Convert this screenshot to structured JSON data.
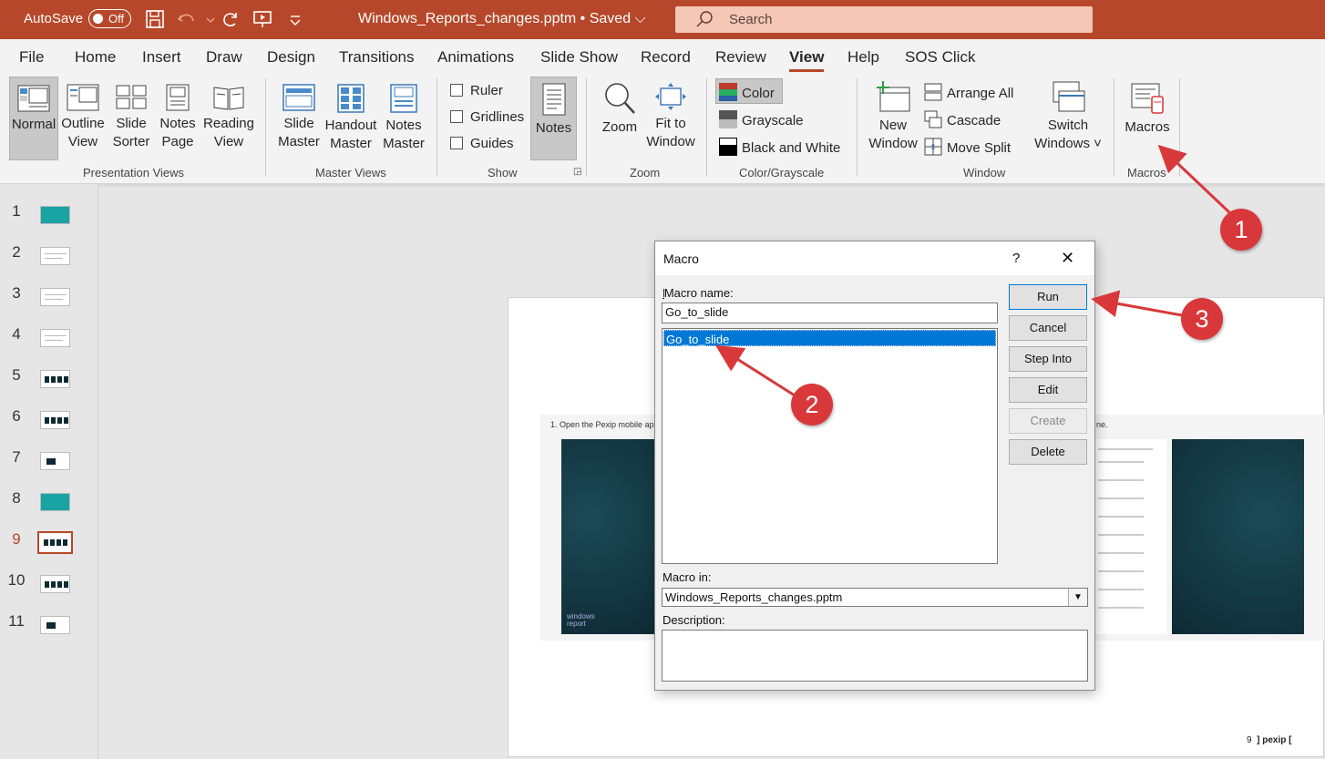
{
  "titlebar": {
    "autosave_label": "AutoSave",
    "autosave_state": "Off",
    "document_title": "Windows_Reports_changes.pptm • Saved ⌵",
    "search_placeholder": "Search"
  },
  "menu": {
    "tabs": [
      "File",
      "Home",
      "Insert",
      "Draw",
      "Design",
      "Transitions",
      "Animations",
      "Slide Show",
      "Record",
      "Review",
      "View",
      "Help",
      "SOS Click"
    ],
    "active": "View"
  },
  "ribbon": {
    "presentation_views": {
      "label": "Presentation Views",
      "normal": "Normal",
      "outline_1": "Outline",
      "outline_2": "View",
      "sorter_1": "Slide",
      "sorter_2": "Sorter",
      "notes_page_1": "Notes",
      "notes_page_2": "Page",
      "reading_1": "Reading",
      "reading_2": "View"
    },
    "master_views": {
      "label": "Master Views",
      "slide_1": "Slide",
      "slide_2": "Master",
      "handout_1": "Handout",
      "handout_2": "Master",
      "notes_1": "Notes",
      "notes_2": "Master"
    },
    "show": {
      "label": "Show",
      "ruler": "Ruler",
      "gridlines": "Gridlines",
      "guides": "Guides",
      "notes": "Notes"
    },
    "zoom": {
      "label": "Zoom",
      "zoom": "Zoom",
      "fit_1": "Fit to",
      "fit_2": "Window"
    },
    "color": {
      "label": "Color/Grayscale",
      "color": "Color",
      "grayscale": "Grayscale",
      "bw": "Black and White"
    },
    "window": {
      "label": "Window",
      "new_1": "New",
      "new_2": "Window",
      "arrange": "Arrange All",
      "cascade": "Cascade",
      "move_split": "Move Split",
      "switch_1": "Switch",
      "switch_2": "Windows ˅"
    },
    "macros": {
      "label": "Macros",
      "button": "Macros"
    }
  },
  "slides": {
    "numbers": [
      "1",
      "2",
      "3",
      "4",
      "5",
      "6",
      "7",
      "8",
      "9",
      "10",
      "11"
    ],
    "current": "9"
  },
  "slide_content": {
    "text": "1.  Open the Pexip mobile app",
    "text_tail": "ne.",
    "logo_1": "windows",
    "logo_2": "report",
    "page_num": "9",
    "brand": "] pexip ["
  },
  "dialog": {
    "title": "Macro",
    "help": "?",
    "close": "✕",
    "macro_name_label": "Macro name:",
    "macro_name_value": "Go_to_slide",
    "list_items": [
      "Go_to_slide"
    ],
    "buttons": {
      "run": "Run",
      "cancel": "Cancel",
      "step_into": "Step Into",
      "edit": "Edit",
      "create": "Create",
      "delete": "Delete"
    },
    "macro_in_label": "Macro in:",
    "macro_in_value": "Windows_Reports_changes.pptm",
    "description_label": "Description:",
    "description_value": ""
  },
  "annotations": [
    "1",
    "2",
    "3"
  ],
  "colors": {
    "accent": "#b7472a",
    "annotation": "#d9383a",
    "selection": "#0078d7"
  }
}
